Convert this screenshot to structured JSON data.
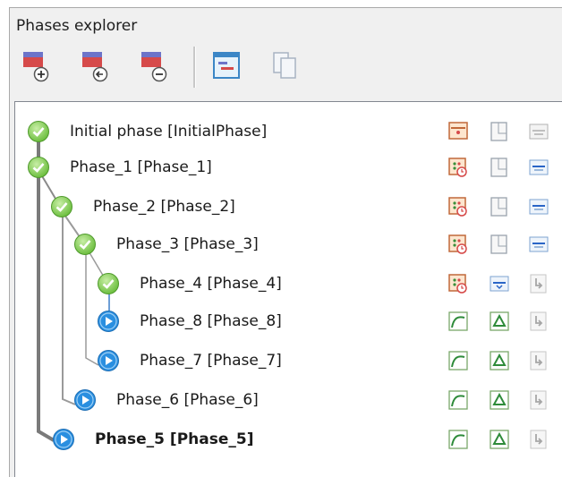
{
  "panel": {
    "title": "Phases explorer"
  },
  "toolbar": {
    "buttons": [
      {
        "icon": "insert-phase-icon"
      },
      {
        "icon": "insert-phase-before-icon"
      },
      {
        "icon": "delete-phase-icon"
      },
      {
        "icon": "phase-properties-icon"
      },
      {
        "icon": "copy-phase-icon"
      }
    ]
  },
  "phases": [
    {
      "label": "Initial phase [InitialPhase]",
      "status": "calculated",
      "bold": false
    },
    {
      "label": "Phase_1 [Phase_1]",
      "status": "calculated",
      "bold": false
    },
    {
      "label": "Phase_2 [Phase_2]",
      "status": "calculated",
      "bold": false
    },
    {
      "label": "Phase_3 [Phase_3]",
      "status": "calculated",
      "bold": false
    },
    {
      "label": "Phase_4 [Phase_4]",
      "status": "calculated",
      "bold": false
    },
    {
      "label": "Phase_8 [Phase_8]",
      "status": "to-calculate",
      "bold": false
    },
    {
      "label": "Phase_7 [Phase_7]",
      "status": "to-calculate",
      "bold": false
    },
    {
      "label": "Phase_6 [Phase_6]",
      "status": "to-calculate",
      "bold": false
    },
    {
      "label": "Phase_5 [Phase_5]",
      "status": "to-calculate",
      "bold": true
    }
  ],
  "colors": {
    "calculated": "#6dbf3f",
    "to_calculate": "#2a8fe0",
    "tree_line": "#7a7a7a"
  }
}
